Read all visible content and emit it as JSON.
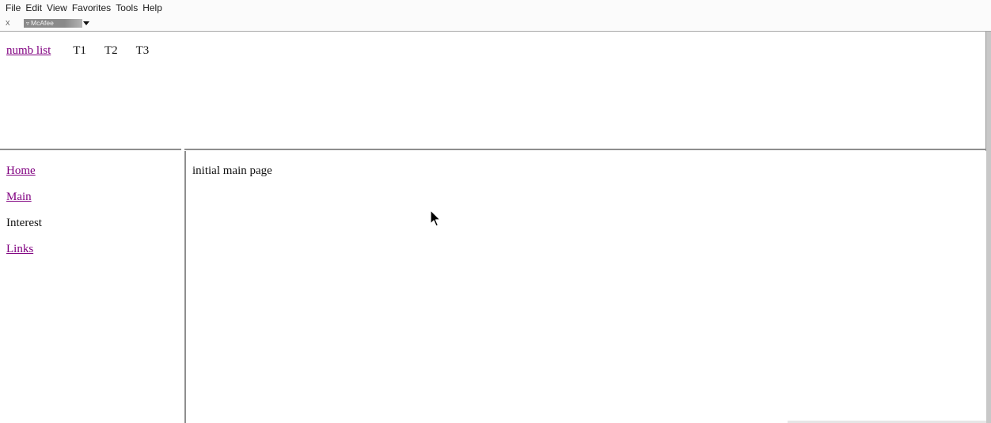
{
  "menubar": {
    "items": [
      "File",
      "Edit",
      "View",
      "Favorites",
      "Tools",
      "Help"
    ]
  },
  "toolbar": {
    "close_glyph": "x",
    "addon_label": "McAfee",
    "addon_icon": "mcafee-shield-icon"
  },
  "top_frame": {
    "link_label": "numb list",
    "tabs": [
      "T1",
      "T2",
      "T3"
    ]
  },
  "left_frame": {
    "items": [
      {
        "label": "Home",
        "is_link": true
      },
      {
        "label": "Main",
        "is_link": true
      },
      {
        "label": "Interest",
        "is_link": false
      },
      {
        "label": "Links",
        "is_link": true
      }
    ]
  },
  "main_frame": {
    "text": "initial main page"
  },
  "colors": {
    "visited_link": "#800080",
    "text": "#111111",
    "divider": "#8e8e8e"
  },
  "cursor": {
    "icon": "mouse-pointer-icon"
  }
}
